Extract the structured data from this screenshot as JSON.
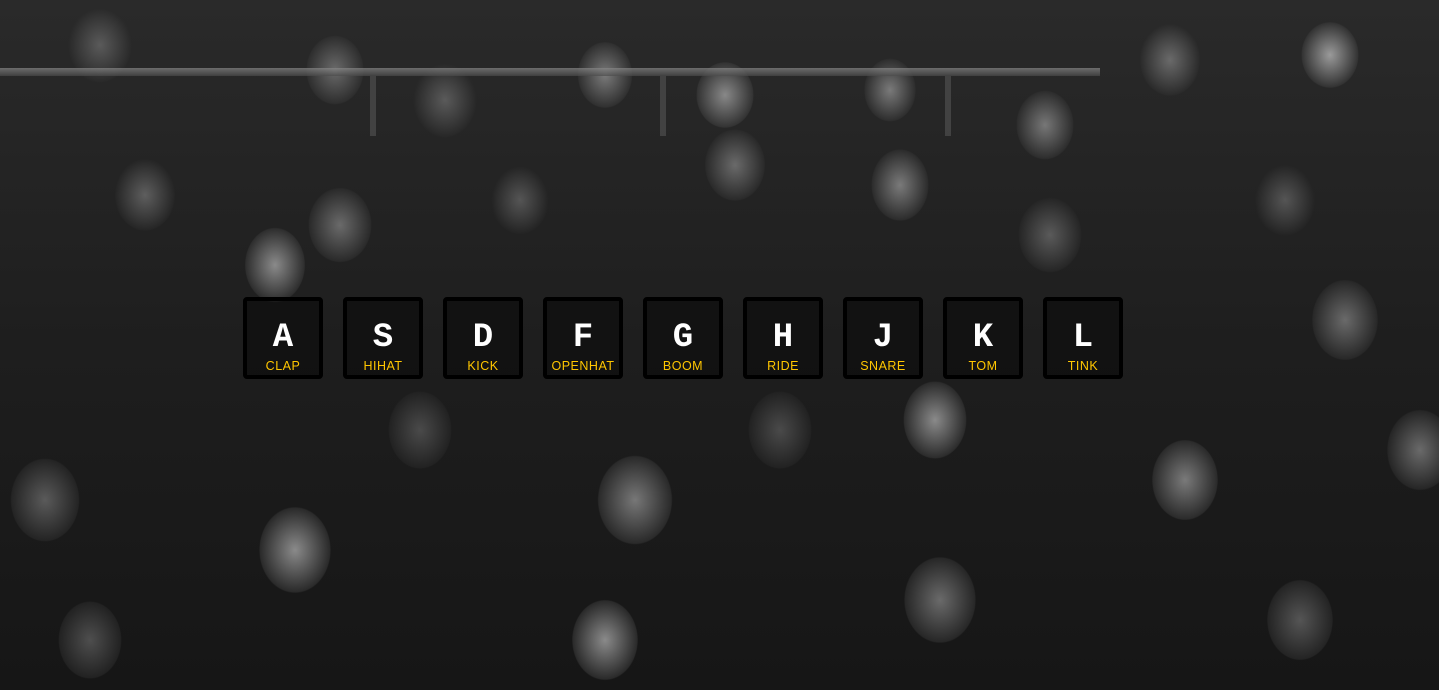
{
  "background": {
    "description": "black-and-white crowd photo"
  },
  "colors": {
    "sound_label": "#ffc600",
    "key_border": "#000000",
    "key_letter": "#ffffff"
  },
  "keys": [
    {
      "key": "A",
      "sound": "clap"
    },
    {
      "key": "S",
      "sound": "hihat"
    },
    {
      "key": "D",
      "sound": "kick"
    },
    {
      "key": "F",
      "sound": "openhat"
    },
    {
      "key": "G",
      "sound": "boom"
    },
    {
      "key": "H",
      "sound": "ride"
    },
    {
      "key": "J",
      "sound": "snare"
    },
    {
      "key": "K",
      "sound": "tom"
    },
    {
      "key": "L",
      "sound": "tink"
    }
  ]
}
